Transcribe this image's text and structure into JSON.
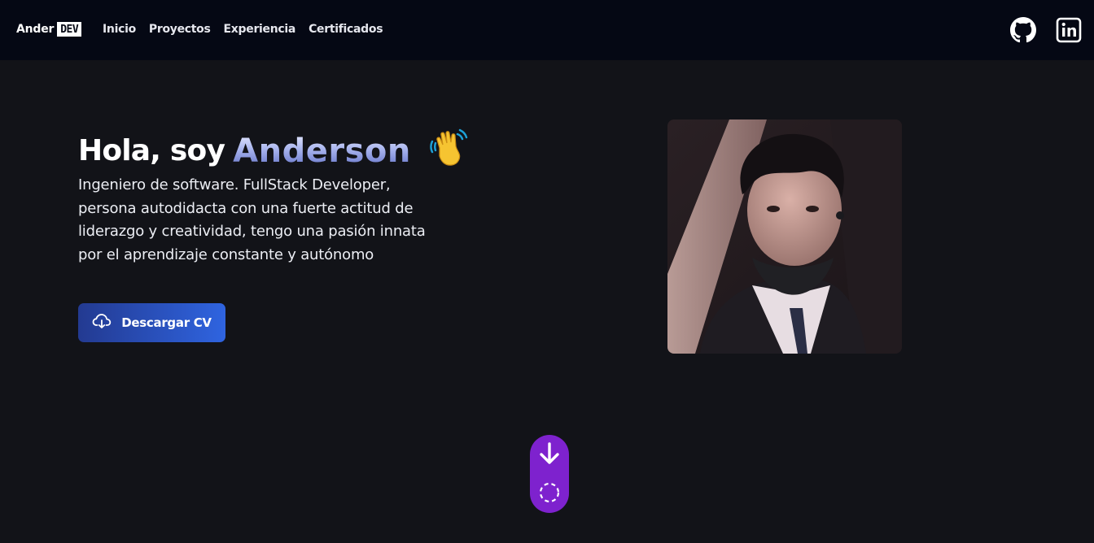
{
  "header": {
    "brand_name": "Ander",
    "brand_tag": "DEV",
    "nav": [
      {
        "label": "Inicio"
      },
      {
        "label": "Proyectos"
      },
      {
        "label": "Experiencia"
      },
      {
        "label": "Certificados"
      }
    ],
    "social_icons": [
      "github-icon",
      "linkedin-icon"
    ]
  },
  "hero": {
    "greeting": "Hola, soy",
    "name": "Anderson",
    "emoji": "waving-hand-icon",
    "description": "Ingeniero de software. FullStack Developer, persona autodidacta con una fuerte actitud de liderazgo y creatividad, tengo una pasión innata por el aprendizaje constante y autónomo",
    "cv_button_label": "Descargar CV",
    "cv_button_icon": "cloud-download-icon"
  },
  "scroll_indicator": {
    "icons": [
      "arrow-down-icon",
      "dashed-circle-icon"
    ],
    "color": "#7e22ce"
  },
  "colors": {
    "background": "#121318",
    "header_background": "#050814",
    "button_gradient_start": "#233a91",
    "button_gradient_end": "#2f64e0"
  }
}
